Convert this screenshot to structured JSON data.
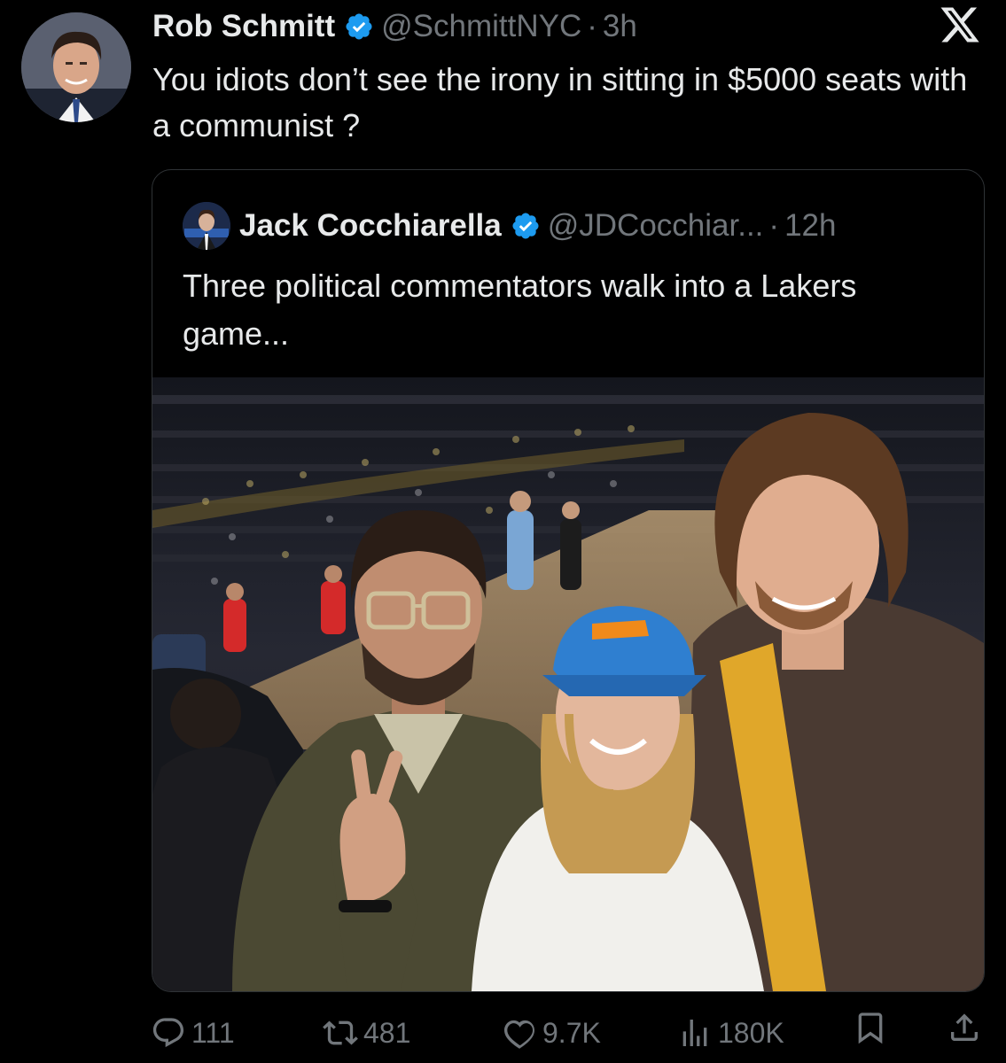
{
  "tweet": {
    "display_name": "Rob Schmitt",
    "handle": "@SchmittNYC",
    "separator": "·",
    "timestamp": "3h",
    "text": "You idiots don’t see the irony in sitting in $5000 seats with a communist ?"
  },
  "quoted_tweet": {
    "display_name": "Jack Cocchiarella",
    "handle": "@JDCocchiar...",
    "separator": "·",
    "timestamp": "12h",
    "text": "Three political commentators walk into a Lakers game..."
  },
  "actions": {
    "replies": "111",
    "reposts": "481",
    "likes": "9.7K",
    "views": "180K"
  },
  "icons": {
    "brand": "x-logo-icon",
    "verified": "verified-badge-icon",
    "reply": "reply-icon",
    "repost": "repost-icon",
    "like": "like-icon",
    "views": "views-icon",
    "bookmark": "bookmark-icon",
    "share": "share-icon"
  },
  "colors": {
    "background": "#000000",
    "text_primary": "#e7e9ea",
    "text_secondary": "#71767b",
    "verified_blue": "#1d9bf0",
    "card_border": "#2f3336"
  }
}
